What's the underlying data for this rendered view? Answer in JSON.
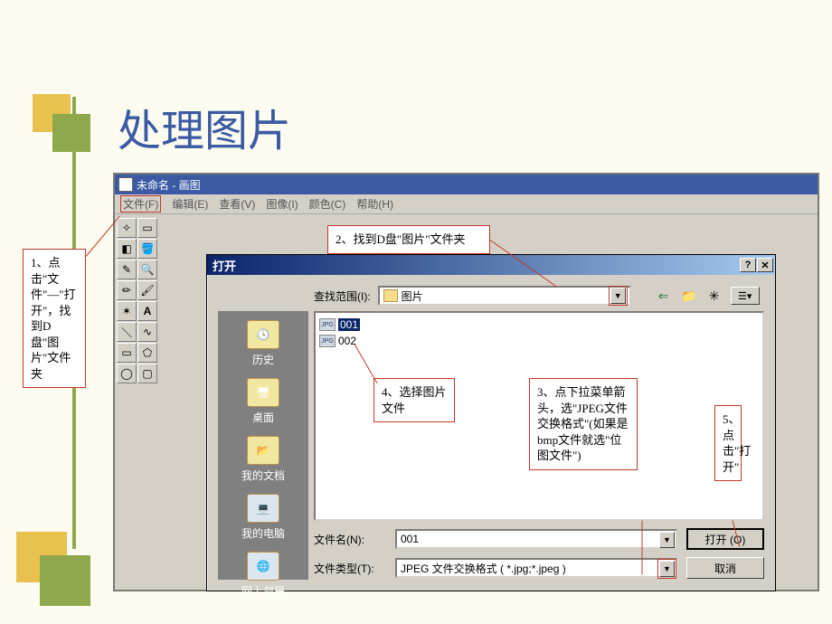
{
  "slide": {
    "title": "处理图片"
  },
  "paint": {
    "title": "未命名 - 画图",
    "menus": {
      "file": "文件(F)",
      "edit": "编辑(E)",
      "view": "查看(V)",
      "image": "图像(I)",
      "color": "颜色(C)",
      "help": "帮助(H)"
    },
    "tools": {
      "freeform": "✧",
      "select": "▭",
      "eraser": "◧",
      "fill": "🪣",
      "picker": "✎",
      "zoom": "🔍",
      "pencil": "✏",
      "brush": "🖌",
      "spray": "✶",
      "text": "A",
      "line": "＼",
      "curve": "∿",
      "rect": "▭",
      "poly": "⬠",
      "ellipse": "◯",
      "rrect": "▢"
    }
  },
  "openDialog": {
    "title": "打开",
    "help": "?",
    "close": "✕",
    "lookin_label": "查找范围(I):",
    "lookin_value": "图片",
    "toolbar": {
      "back": "⇐",
      "up": "📁",
      "new": "✳",
      "views": "☰▾"
    },
    "places": {
      "history": "历史",
      "desktop": "桌面",
      "mydocs": "我的文档",
      "mycomp": "我的电脑",
      "network": "网上邻居"
    },
    "files": [
      {
        "name": "001",
        "selected": true
      },
      {
        "name": "002",
        "selected": false
      }
    ],
    "file_thumb_tag": "JPG",
    "filename_label": "文件名(N):",
    "filename_value": "001",
    "filetype_label": "文件类型(T):",
    "filetype_value": "JPEG 文件交换格式 ( *.jpg;*.jpeg )",
    "open_btn": "打开 (O)",
    "cancel_btn": "取消"
  },
  "annotations": {
    "a1": "1、点击\"文件\"—\"打开\"，找到D盘\"图片\"文件夹",
    "a2": "2、找到D盘\"图片\"文件夹",
    "a3": "3、点下拉菜单箭头，选\"JPEG文件交换格式\"(如果是bmp文件就选\"位图文件\")",
    "a4": "4、选择图片文件",
    "a5": "5、点击\"打开\""
  }
}
